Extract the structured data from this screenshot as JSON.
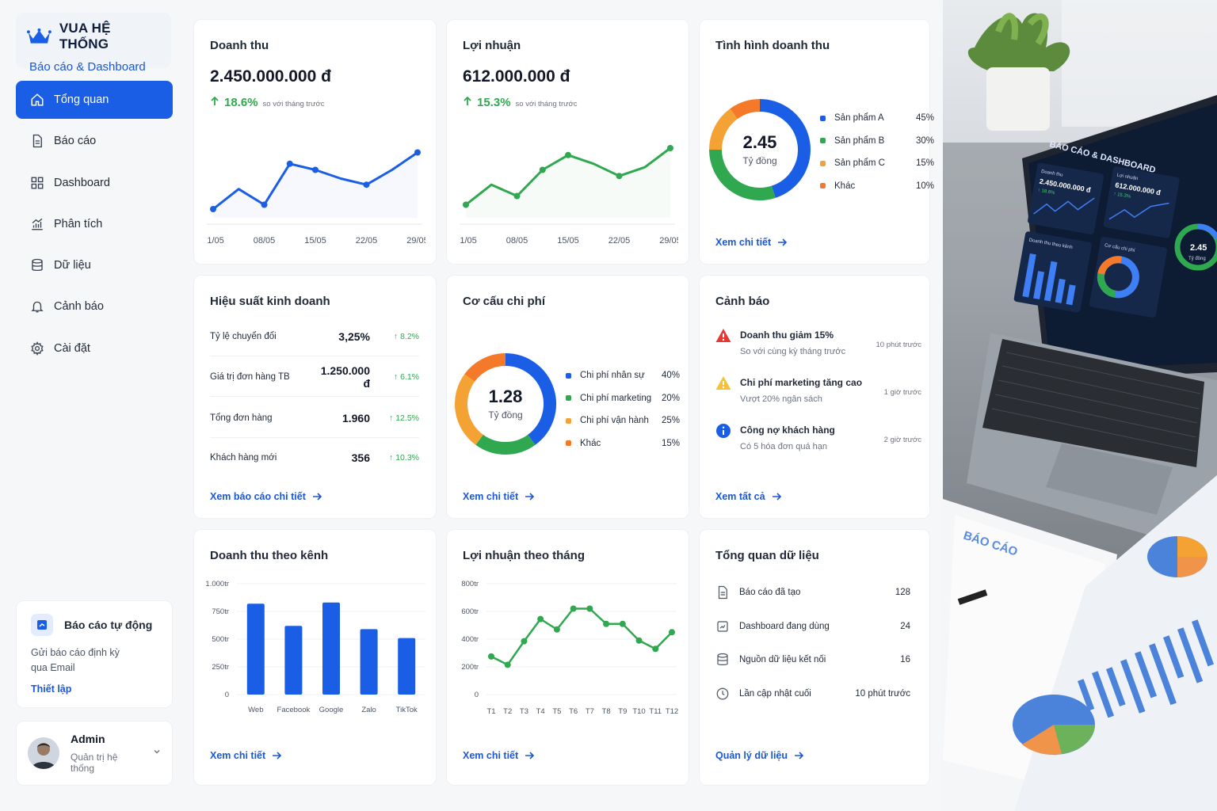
{
  "brand": {
    "title": "VUA HỆ THỐNG",
    "subtitle": "Báo cáo & Dashboard"
  },
  "nav": [
    {
      "label": "Tổng quan",
      "icon": "home-icon"
    },
    {
      "label": "Báo cáo",
      "icon": "document-icon"
    },
    {
      "label": "Dashboard",
      "icon": "grid-icon"
    },
    {
      "label": "Phân tích",
      "icon": "analytics-icon"
    },
    {
      "label": "Dữ liệu",
      "icon": "database-icon"
    },
    {
      "label": "Cảnh báo",
      "icon": "bell-icon"
    },
    {
      "label": "Cài đặt",
      "icon": "gear-icon"
    }
  ],
  "auto_report": {
    "title": "Báo cáo tự động",
    "desc": "Gửi báo cáo định kỳ qua Email",
    "link": "Thiết lập"
  },
  "user": {
    "name": "Admin",
    "role": "Quản trị hệ thống"
  },
  "revenue": {
    "title": "Doanh thu",
    "value": "2.450.000.000 đ",
    "trend": "18.6%",
    "note": "so với tháng trước"
  },
  "profit": {
    "title": "Lợi nhuận",
    "value": "612.000.000 đ",
    "trend": "15.3%",
    "note": "so với tháng trước"
  },
  "revenue_status": {
    "title": "Tình hình doanh thu",
    "center_value": "2.45",
    "center_unit": "Tỷ đồng",
    "link": "Xem chi tiết"
  },
  "performance": {
    "title": "Hiệu suất kinh doanh",
    "rows": [
      {
        "label": "Tỷ lệ chuyển đổi",
        "value": "3,25%",
        "trend": "8.2%"
      },
      {
        "label": "Giá trị đơn hàng TB",
        "value": "1.250.000 đ",
        "trend": "6.1%"
      },
      {
        "label": "Tổng đơn hàng",
        "value": "1.960",
        "trend": "12.5%"
      },
      {
        "label": "Khách hàng mới",
        "value": "356",
        "trend": "10.3%"
      }
    ],
    "link": "Xem báo cáo chi tiết"
  },
  "cost": {
    "title": "Cơ cấu chi phí",
    "center_value": "1.28",
    "center_unit": "Tỷ đồng",
    "link": "Xem chi tiết"
  },
  "alerts": {
    "title": "Cảnh báo",
    "items": [
      {
        "icon": "warning-red-icon",
        "title": "Doanh thu giảm 15%",
        "sub": "So với cùng kỳ tháng trước",
        "time": "10 phút trước"
      },
      {
        "icon": "warning-yellow-icon",
        "title": "Chi phí marketing tăng cao",
        "sub": "Vượt 20% ngân sách",
        "time": "1 giờ trước"
      },
      {
        "icon": "info-icon",
        "title": "Công nợ khách hàng",
        "sub": "Có 5 hóa đơn quá hạn",
        "time": "2 giờ trước"
      }
    ],
    "link": "Xem tất cả"
  },
  "channel": {
    "title": "Doanh thu theo kênh",
    "link": "Xem chi tiết"
  },
  "monthly": {
    "title": "Lợi nhuận theo tháng",
    "link": "Xem chi tiết"
  },
  "overview": {
    "title": "Tổng quan dữ liệu",
    "rows": [
      {
        "icon": "document-icon",
        "label": "Báo cáo đã tạo",
        "value": "128"
      },
      {
        "icon": "dashboard-icon",
        "label": "Dashboard đang dùng",
        "value": "24"
      },
      {
        "icon": "database-icon",
        "label": "Nguồn dữ liệu kết nối",
        "value": "16"
      },
      {
        "icon": "clock-icon",
        "label": "Lần cập nhật cuối",
        "value": "10 phút trước"
      }
    ],
    "link": "Quản lý dữ liệu"
  },
  "photo": {
    "laptop_title": "BÁO CÁO & DASHBOARD",
    "laptop_revenue_label": "Doanh thu",
    "laptop_revenue": "2.450.000.000 đ",
    "laptop_trend": "↑ 18.6%",
    "laptop_profit_label": "Lợi nhuận",
    "laptop_profit": "612.000.000 đ",
    "laptop_profit_trend": "↑ 15.3%",
    "laptop_donut": "2.45",
    "laptop_donut_unit": "Tỷ đồng",
    "laptop_channel": "Doanh thu theo kênh",
    "laptop_cost": "Cơ cấu chi phí",
    "paper_title": "BÁO CÁO"
  },
  "colors": {
    "blue": "#1b5ee6",
    "green": "#2fa84f",
    "orange": "#f5a234",
    "orange_dark": "#f47a2a",
    "yellow": "#f5c03a"
  },
  "chart_data": [
    {
      "type": "area",
      "name": "revenue-trend",
      "x": [
        "01/05",
        "04/05",
        "08/05",
        "11/05",
        "15/05",
        "18/05",
        "22/05",
        "25/05",
        "29/05"
      ],
      "y": [
        10,
        33,
        15,
        62,
        55,
        45,
        38,
        55,
        75
      ],
      "ylim": [
        0,
        100
      ]
    },
    {
      "type": "area",
      "name": "profit-trend",
      "x": [
        "01/05",
        "04/05",
        "08/05",
        "11/05",
        "15/05",
        "18/05",
        "22/05",
        "25/05",
        "29/05"
      ],
      "y": [
        15,
        38,
        25,
        55,
        72,
        62,
        48,
        58,
        80
      ],
      "ylim": [
        0,
        100
      ]
    },
    {
      "type": "pie",
      "name": "revenue-breakdown",
      "categories": [
        "Sản phẩm A",
        "Sản phẩm B",
        "Sản phẩm C",
        "Khác"
      ],
      "values": [
        45,
        30,
        15,
        10
      ],
      "labels": [
        "45%",
        "30%",
        "15%",
        "10%"
      ]
    },
    {
      "type": "pie",
      "name": "cost-breakdown",
      "categories": [
        "Chi phí nhân sự",
        "Chi phí marketing",
        "Chi phí vận hành",
        "Khác"
      ],
      "values": [
        40,
        20,
        25,
        15
      ],
      "labels": [
        "40%",
        "20%",
        "25%",
        "15%"
      ]
    },
    {
      "type": "bar",
      "name": "channel-revenue",
      "categories": [
        "Web",
        "Facebook",
        "Google",
        "Zalo",
        "TikTok"
      ],
      "values": [
        820,
        620,
        830,
        590,
        510
      ],
      "ylim": [
        0,
        1000
      ],
      "yticks": [
        "0",
        "250tr",
        "500tr",
        "750tr",
        "1.000tr"
      ]
    },
    {
      "type": "line",
      "name": "monthly-profit",
      "categories": [
        "T1",
        "T2",
        "T3",
        "T4",
        "T5",
        "T6",
        "T7",
        "T8",
        "T9",
        "T10",
        "T11",
        "T12"
      ],
      "values": [
        275,
        215,
        385,
        545,
        470,
        620,
        620,
        510,
        510,
        390,
        330,
        450
      ],
      "ylim": [
        0,
        800
      ],
      "yticks": [
        "0",
        "200tr",
        "400tr",
        "600tr",
        "800tr"
      ]
    }
  ]
}
